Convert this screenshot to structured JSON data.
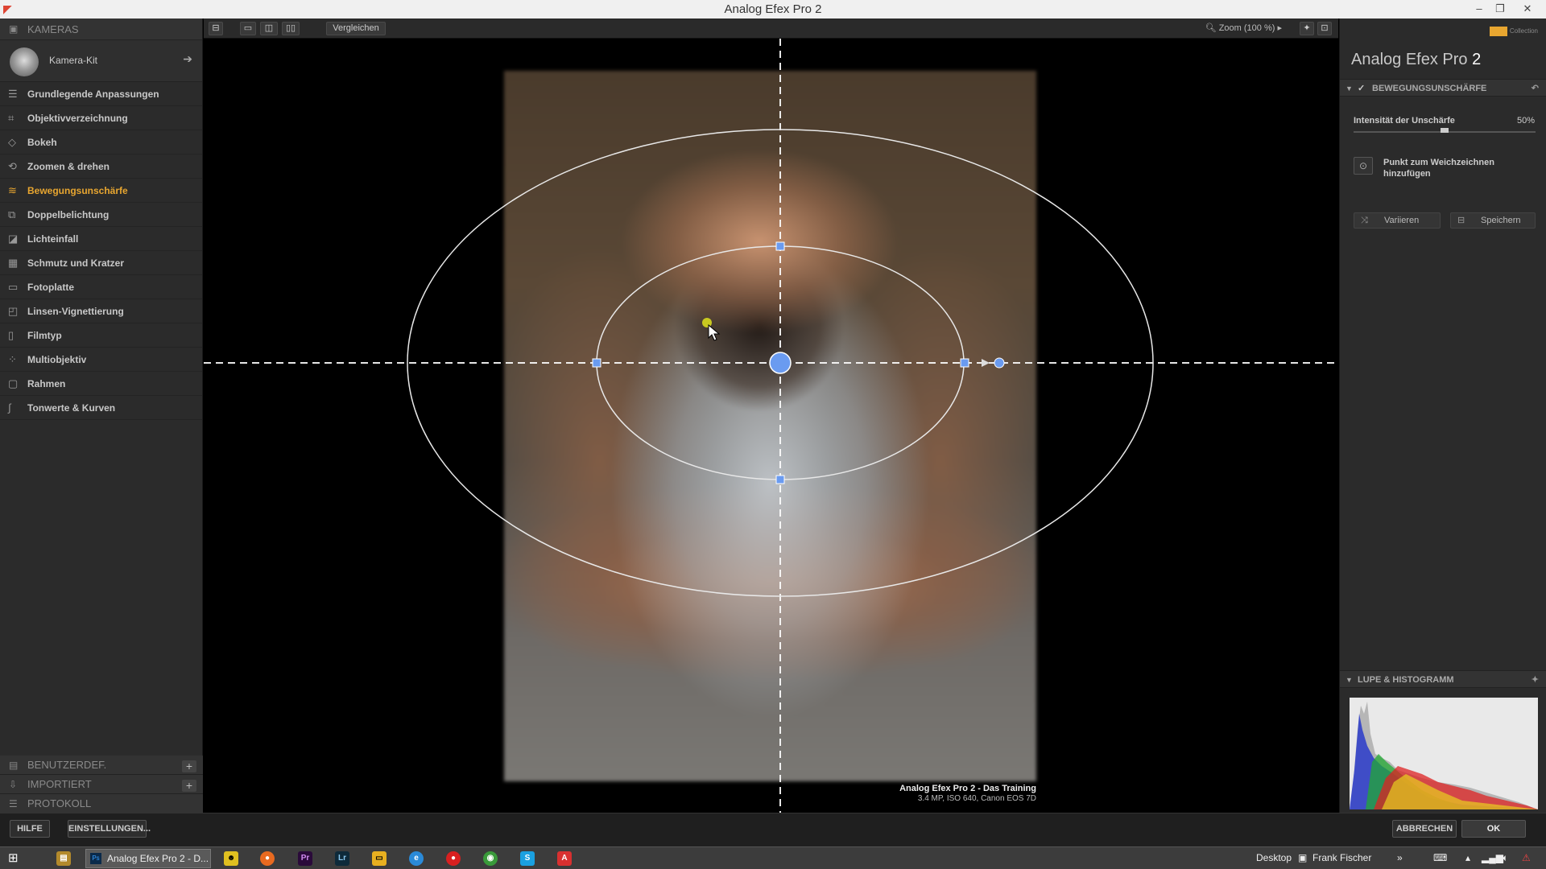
{
  "window": {
    "title": "Analog Efex Pro 2"
  },
  "left_panel": {
    "cameras_header": "KAMERAS",
    "camera_kit_label": "Kamera-Kit",
    "filters": [
      {
        "label": "Grundlegende Anpassungen",
        "icon": "sliders-icon"
      },
      {
        "label": "Objektivverzeichnung",
        "icon": "lens-distortion-icon"
      },
      {
        "label": "Bokeh",
        "icon": "bokeh-icon"
      },
      {
        "label": "Zoomen & drehen",
        "icon": "rotate-icon"
      },
      {
        "label": "Bewegungsunschärfe",
        "icon": "motion-blur-icon",
        "active": true
      },
      {
        "label": "Doppelbelichtung",
        "icon": "double-exposure-icon"
      },
      {
        "label": "Lichteinfall",
        "icon": "light-leak-icon"
      },
      {
        "label": "Schmutz und Kratzer",
        "icon": "dirt-scratches-icon"
      },
      {
        "label": "Fotoplatte",
        "icon": "photo-plate-icon"
      },
      {
        "label": "Linsen-Vignettierung",
        "icon": "vignette-icon"
      },
      {
        "label": "Filmtyp",
        "icon": "film-type-icon"
      },
      {
        "label": "Multiobjektiv",
        "icon": "multi-lens-icon"
      },
      {
        "label": "Rahmen",
        "icon": "frame-icon"
      },
      {
        "label": "Tonwerte & Kurven",
        "icon": "curves-icon"
      }
    ],
    "user_defined_header": "BENUTZERDEF.",
    "imported_header": "IMPORTIERT",
    "protocol_header": "PROTOKOLL"
  },
  "toolbar": {
    "compare_label": "Vergleichen",
    "zoom_label": "Zoom (100 %)"
  },
  "canvas": {
    "caption_title": "Analog Efex Pro 2 - Das Training",
    "caption_meta": "3.4 MP, ISO 640, Canon EOS 7D"
  },
  "right_panel": {
    "logo_text": "Collection",
    "app_title": "Analog Efex Pro",
    "app_version": "2",
    "section_title": "BEWEGUNGSUNSCHÄRFE",
    "intensity_label": "Intensität der Unschärfe",
    "intensity_value": "50%",
    "intensity_fraction": 0.5,
    "add_point_label": "Punkt zum Weichzeichnen hinzufügen",
    "vary_label": "Variieren",
    "save_label": "Speichern",
    "loupe_title": "LUPE & HISTOGRAMM"
  },
  "bottom_bar": {
    "help_label": "HILFE",
    "settings_label": "EINSTELLUNGEN...",
    "cancel_label": "ABBRECHEN",
    "ok_label": "OK"
  },
  "taskbar": {
    "active_app_label": "Analog Efex Pro 2 - D...",
    "desktop_label": "Desktop",
    "user_label": "Frank Fischer"
  },
  "colors": {
    "accent": "#e8a630",
    "panel_bg": "#2b2b2b",
    "control_point": "#6a9bf0"
  }
}
